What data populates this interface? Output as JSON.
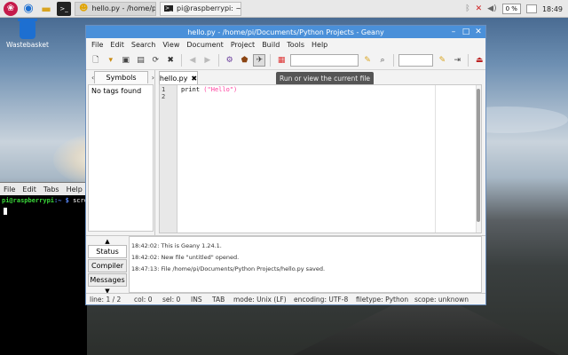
{
  "taskbar": {
    "tasks": [
      {
        "label": "hello.py - /home/pi/...",
        "active": true
      },
      {
        "label": "pi@raspberrypi: ~",
        "active": false
      }
    ],
    "volume": "0 %",
    "clock": "18:49"
  },
  "desktop": {
    "trash_label": "Wastebasket"
  },
  "terminal": {
    "menu": [
      "File",
      "Edit",
      "Tabs",
      "Help"
    ],
    "prompt_user": "pi@raspberrypi",
    "prompt_path": ":~ $",
    "command": "scrot"
  },
  "geany": {
    "title": "hello.py - /home/pi/Documents/Python Projects - Geany",
    "menu": [
      "File",
      "Edit",
      "Search",
      "View",
      "Document",
      "Project",
      "Build",
      "Tools",
      "Help"
    ],
    "tooltip": "Run or view the current file",
    "sidebar": {
      "tab_label": "Symbols",
      "empty_text": "No tags found"
    },
    "editor": {
      "tab_label": "hello.py",
      "line_numbers": [
        "1",
        "2"
      ],
      "code_keyword": "print",
      "code_string": "(\"Hello\")"
    },
    "messages": {
      "tabs": [
        "Status",
        "Compiler",
        "Messages"
      ],
      "lines": [
        "18:42:02: This is Geany 1.24.1.",
        "18:42:02: New file \"untitled\" opened.",
        "18:47:13: File /home/pi/Documents/Python Projects/hello.py saved."
      ]
    },
    "statusbar": {
      "line": "line: 1 / 2",
      "col": "col: 0",
      "sel": "sel: 0",
      "ins": "INS",
      "tab": "TAB",
      "mode": "mode: Unix (LF)",
      "encoding": "encoding: UTF-8",
      "filetype": "filetype: Python",
      "scope": "scope: unknown"
    }
  }
}
